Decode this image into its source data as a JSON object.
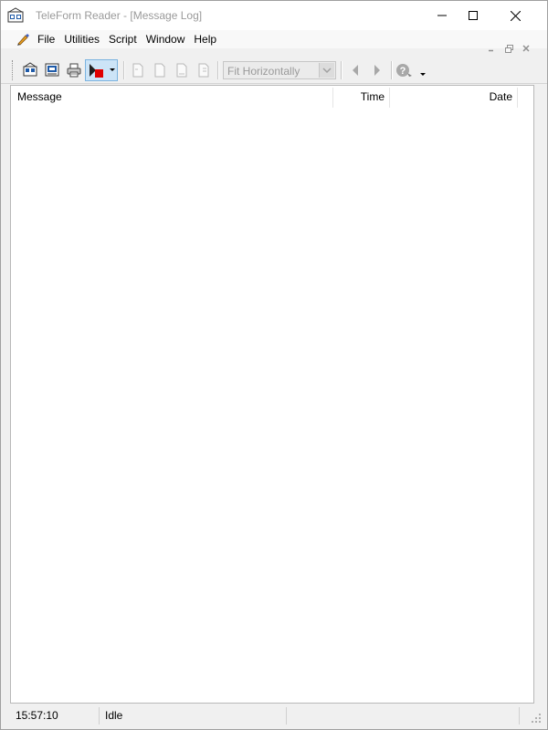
{
  "window": {
    "title": "TeleForm Reader - [Message Log]",
    "controls": {
      "minimize": "minimize-icon",
      "maximize": "maximize-icon",
      "close": "close-icon"
    }
  },
  "menu": {
    "items": [
      {
        "label": "File"
      },
      {
        "label": "Utilities"
      },
      {
        "label": "Script"
      },
      {
        "label": "Window"
      },
      {
        "label": "Help"
      }
    ]
  },
  "toolbar": {
    "zoom": {
      "selected": "Fit Horizontally"
    }
  },
  "message_log": {
    "columns": [
      {
        "label": "Message"
      },
      {
        "label": "Time"
      },
      {
        "label": "Date"
      }
    ],
    "rows": []
  },
  "status": {
    "time": "15:57:10",
    "state": "Idle"
  },
  "colors": {
    "title_text": "#9a9a9a",
    "active_button_bg": "#cce4f7",
    "run_red": "#e00000",
    "run_black": "#202020",
    "icon_blue": "#1e5aa8"
  }
}
